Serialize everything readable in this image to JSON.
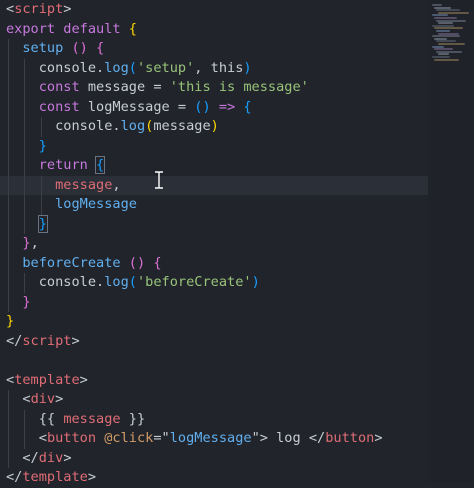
{
  "lines": [
    {
      "indent": 0,
      "tokens": [
        {
          "t": "<",
          "c": "plain"
        },
        {
          "t": "script",
          "c": "tag"
        },
        {
          "t": ">",
          "c": "plain"
        }
      ]
    },
    {
      "indent": 0,
      "tokens": [
        {
          "t": "export default ",
          "c": "kw"
        },
        {
          "t": "{",
          "c": "br1"
        }
      ]
    },
    {
      "indent": 1,
      "tokens": [
        {
          "t": "setup ",
          "c": "fn"
        },
        {
          "t": "()",
          "c": "br2"
        },
        {
          "t": " ",
          "c": "plain"
        },
        {
          "t": "{",
          "c": "br2"
        }
      ]
    },
    {
      "indent": 2,
      "tokens": [
        {
          "t": "console",
          "c": "plain"
        },
        {
          "t": ".",
          "c": "plain"
        },
        {
          "t": "log",
          "c": "fn"
        },
        {
          "t": "(",
          "c": "br3"
        },
        {
          "t": "'setup'",
          "c": "str"
        },
        {
          "t": ", this",
          "c": "plain"
        },
        {
          "t": ")",
          "c": "br3"
        }
      ]
    },
    {
      "indent": 2,
      "tokens": [
        {
          "t": "const ",
          "c": "kw"
        },
        {
          "t": "message",
          "c": "plain"
        },
        {
          "t": " = ",
          "c": "plain"
        },
        {
          "t": "'this is message'",
          "c": "str"
        }
      ]
    },
    {
      "indent": 2,
      "tokens": [
        {
          "t": "const ",
          "c": "kw"
        },
        {
          "t": "logMessage",
          "c": "plain"
        },
        {
          "t": " = ",
          "c": "plain"
        },
        {
          "t": "()",
          "c": "br3"
        },
        {
          "t": " => ",
          "c": "kw"
        },
        {
          "t": "{",
          "c": "br3"
        }
      ]
    },
    {
      "indent": 3,
      "tokens": [
        {
          "t": "console",
          "c": "plain"
        },
        {
          "t": ".",
          "c": "plain"
        },
        {
          "t": "log",
          "c": "fn"
        },
        {
          "t": "(",
          "c": "br1"
        },
        {
          "t": "message",
          "c": "plain"
        },
        {
          "t": ")",
          "c": "br1"
        }
      ]
    },
    {
      "indent": 2,
      "tokens": [
        {
          "t": "}",
          "c": "br3"
        }
      ]
    },
    {
      "indent": 2,
      "tokens": [
        {
          "t": "return ",
          "c": "kw"
        },
        {
          "t": "{",
          "c": "br3",
          "hl": true
        }
      ]
    },
    {
      "indent": 3,
      "active": true,
      "tokens": [
        {
          "t": "message",
          "c": "var"
        },
        {
          "t": ",",
          "c": "plain"
        }
      ]
    },
    {
      "indent": 3,
      "tokens": [
        {
          "t": "logMessage",
          "c": "fn"
        }
      ]
    },
    {
      "indent": 2,
      "tokens": [
        {
          "t": "}",
          "c": "br3",
          "hl": true
        }
      ]
    },
    {
      "indent": 1,
      "tokens": [
        {
          "t": "}",
          "c": "br2"
        },
        {
          "t": ",",
          "c": "plain"
        }
      ]
    },
    {
      "indent": 1,
      "tokens": [
        {
          "t": "beforeCreate ",
          "c": "fn"
        },
        {
          "t": "()",
          "c": "br2"
        },
        {
          "t": " ",
          "c": "plain"
        },
        {
          "t": "{",
          "c": "br2"
        }
      ]
    },
    {
      "indent": 2,
      "tokens": [
        {
          "t": "console",
          "c": "plain"
        },
        {
          "t": ".",
          "c": "plain"
        },
        {
          "t": "log",
          "c": "fn"
        },
        {
          "t": "(",
          "c": "br3"
        },
        {
          "t": "'beforeCreate'",
          "c": "str"
        },
        {
          "t": ")",
          "c": "br3"
        }
      ]
    },
    {
      "indent": 1,
      "tokens": [
        {
          "t": "}",
          "c": "br2"
        }
      ]
    },
    {
      "indent": 0,
      "tokens": [
        {
          "t": "}",
          "c": "br1"
        }
      ]
    },
    {
      "indent": 0,
      "tokens": [
        {
          "t": "</",
          "c": "plain"
        },
        {
          "t": "script",
          "c": "tag"
        },
        {
          "t": ">",
          "c": "plain"
        }
      ]
    },
    {
      "indent": 0,
      "tokens": []
    },
    {
      "indent": 0,
      "tokens": [
        {
          "t": "<",
          "c": "plain"
        },
        {
          "t": "template",
          "c": "tag"
        },
        {
          "t": ">",
          "c": "plain"
        }
      ]
    },
    {
      "indent": 1,
      "tokens": [
        {
          "t": "<",
          "c": "plain"
        },
        {
          "t": "div",
          "c": "tag"
        },
        {
          "t": ">",
          "c": "plain"
        }
      ]
    },
    {
      "indent": 2,
      "tokens": [
        {
          "t": "{{ ",
          "c": "plain"
        },
        {
          "t": "message",
          "c": "var"
        },
        {
          "t": " }}",
          "c": "plain"
        }
      ]
    },
    {
      "indent": 2,
      "tokens": [
        {
          "t": "<",
          "c": "plain"
        },
        {
          "t": "button",
          "c": "tag"
        },
        {
          "t": " @click",
          "c": "attr"
        },
        {
          "t": "=\"",
          "c": "plain"
        },
        {
          "t": "logMessage",
          "c": "fn"
        },
        {
          "t": "\"",
          "c": "plain"
        },
        {
          "t": "> log </",
          "c": "plain"
        },
        {
          "t": "button",
          "c": "tag"
        },
        {
          "t": ">",
          "c": "plain"
        }
      ]
    },
    {
      "indent": 1,
      "tokens": [
        {
          "t": "</",
          "c": "plain"
        },
        {
          "t": "div",
          "c": "tag"
        },
        {
          "t": ">",
          "c": "plain"
        }
      ]
    },
    {
      "indent": 0,
      "tokens": [
        {
          "t": "</",
          "c": "plain"
        },
        {
          "t": "template",
          "c": "tag"
        },
        {
          "t": ">",
          "c": "plain"
        }
      ]
    }
  ],
  "theme": {
    "background": "#21252b",
    "active_line": "#2a2f38",
    "indent_guide": "#3a3f4a"
  },
  "icons": {
    "cursor": "text-cursor-icon"
  }
}
